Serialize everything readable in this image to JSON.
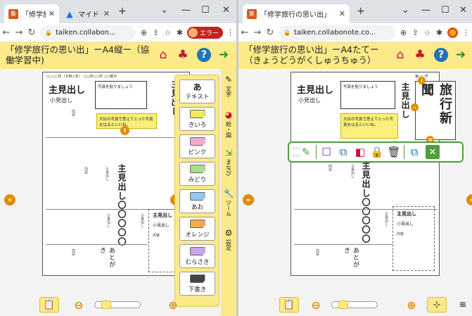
{
  "left": {
    "tabs": [
      {
        "label": "「修学旅行の思い出」",
        "favicon": "集"
      },
      {
        "label": "マイドライブ",
        "favicon": "drive"
      }
    ],
    "url": "taiken.collabon...",
    "profile_label": "エラー",
    "title_line1": "「修学旅行の思い出」ーA4縦ー（協",
    "title_line2": "働学習中)",
    "paper": {
      "header": "○○○○年（令和○年） ○○月○○日 ○○曜日",
      "main_title": "主見出し",
      "sub_title": "小見出し",
      "photo_text": "写真を貼りましょう",
      "note_text": "大伝の写真で思えてとった写真をはるといいね。",
      "vert_main": "主見出し〇〇〇〇〇",
      "vert_sub": "小見出し",
      "small_text": "内容",
      "memo_title": "主見出し",
      "memo_sub": "小見出し",
      "memo_content": "内容",
      "afterword": "あとがき",
      "pen_letter": "I"
    },
    "palette": [
      {
        "label": "テキスト",
        "icon_text": "あ"
      },
      {
        "label": "きいろ",
        "color": "#f3ea5b"
      },
      {
        "label": "ピンク",
        "color": "#f7a9d0"
      },
      {
        "label": "みどり",
        "color": "#a7e08c"
      },
      {
        "label": "あお",
        "color": "#8ec7f2"
      },
      {
        "label": "オレンジ",
        "color": "#f7a94a"
      },
      {
        "label": "むらさき",
        "color": "#c9a4e8"
      },
      {
        "label": "下書き",
        "color": "#444444"
      }
    ],
    "side": [
      {
        "label": "文字",
        "icon": "pencil-icon"
      },
      {
        "label": "絵・図",
        "icon": "palette-icon"
      },
      {
        "label": "まなび",
        "icon": "export-icon"
      },
      {
        "label": "ツール",
        "icon": "wrench-icon"
      },
      {
        "label": "設定",
        "icon": "gear-icon"
      }
    ]
  },
  "right": {
    "tab": {
      "label": "「修学旅行の思い出」",
      "favicon": "集"
    },
    "url": "taiken.collabonote.co...",
    "title_line1": "「修学旅行の思い出」ーA4たてー",
    "title_line2": "（きょうどうがくしゅうちゅう）",
    "paper": {
      "page_label": "第○○号",
      "main_title": "主見出し",
      "sub_title": "小見出し",
      "photo_text": "写真を貼りましょう",
      "note_text": "大伝の写真で思えてとった写真をはるといいね。",
      "vert_title": "旅行新聞",
      "vert_main": "主見出し〇〇〇〇〇",
      "vert_sub": "小見出し",
      "small_text": "内容",
      "memo_title": "主見出し",
      "memo_sub": "小見出し",
      "memo_content": "内容",
      "afterword": "あとがき"
    }
  },
  "colors": {
    "header_bg": "#fbe98a",
    "accent": "#e38a00",
    "green": "#4aa03a",
    "help_blue": "#1e74b7"
  }
}
